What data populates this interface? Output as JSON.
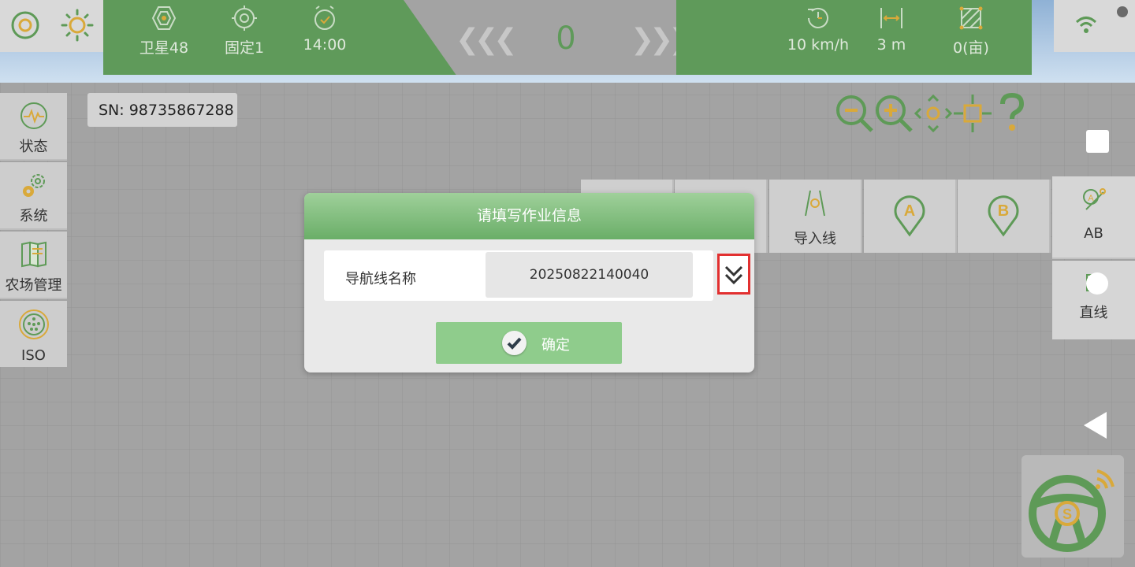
{
  "status_bar": {
    "satellite": "卫星48",
    "fix": "固定1",
    "time": "14:00",
    "speed_center": "0",
    "speed_unit": "10 km/h",
    "width": "3 m",
    "area": "0(亩)"
  },
  "sidebar": {
    "items": [
      {
        "label": "状态",
        "icon": "pulse-icon"
      },
      {
        "label": "系统",
        "icon": "gears-icon"
      },
      {
        "label": "农场管理",
        "icon": "farm-map-icon"
      },
      {
        "label": "ISO",
        "icon": "iso-connector-icon"
      }
    ]
  },
  "sn": "SN: 98735867288",
  "toolbar": {
    "import_line": "导入线",
    "ab_label": "AB",
    "straight_label": "直线",
    "point_a": "A",
    "point_b": "B"
  },
  "dialog": {
    "title": "请填写作业信息",
    "field_label": "导航线名称",
    "field_value": "20250822140040",
    "confirm_label": "确定"
  },
  "steering_logo": "S",
  "colors": {
    "green": "#5f9a5a",
    "dialog_header": "#7dbb79",
    "confirm_button": "#8fcc8c",
    "icon_yellow": "#d9a93a",
    "icon_green": "#5e9a57",
    "highlight_red": "#e23030"
  }
}
